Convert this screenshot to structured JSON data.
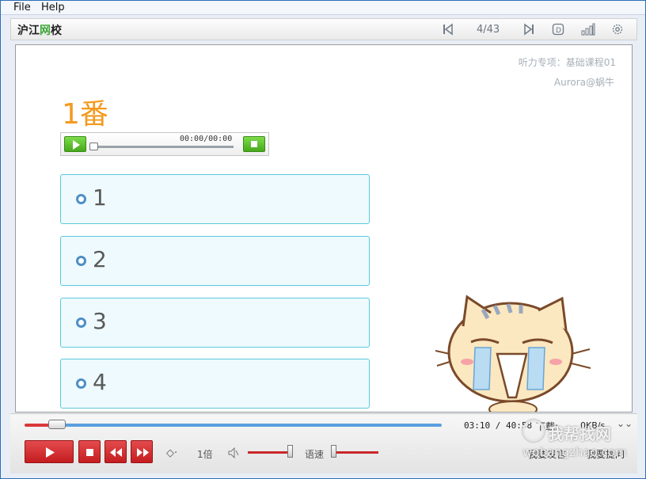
{
  "menu": {
    "file": "File",
    "help": "Help"
  },
  "toolbar": {
    "logo_main": "沪江",
    "logo_accent": "网",
    "logo_tail": "校",
    "page": "4/43",
    "icons": [
      "skip-start-icon",
      "skip-end-icon",
      "d-icon",
      "signal-icon",
      "settings-icon"
    ]
  },
  "slide": {
    "meta_course": "听力专项：基础课程01",
    "meta_author": "Aurora@蜗牛",
    "title": "1番",
    "audio_time": "00:00/00:00",
    "options": [
      "1",
      "2",
      "3",
      "4"
    ]
  },
  "controls": {
    "time": "03:10 / 40:58",
    "download_label": "下载:",
    "speed": "0KB/s",
    "rate": "1倍",
    "speech_rate_label": "语速",
    "link_left": "我要发言",
    "link_right": "我要提问"
  },
  "watermark": {
    "text": "我帮找网",
    "url": "wobangzhao.com"
  },
  "colors": {
    "accent_orange": "#f39a1f",
    "option_border": "#5cc9da",
    "control_red": "#d32f2f",
    "play_green": "#5cbf2a"
  }
}
